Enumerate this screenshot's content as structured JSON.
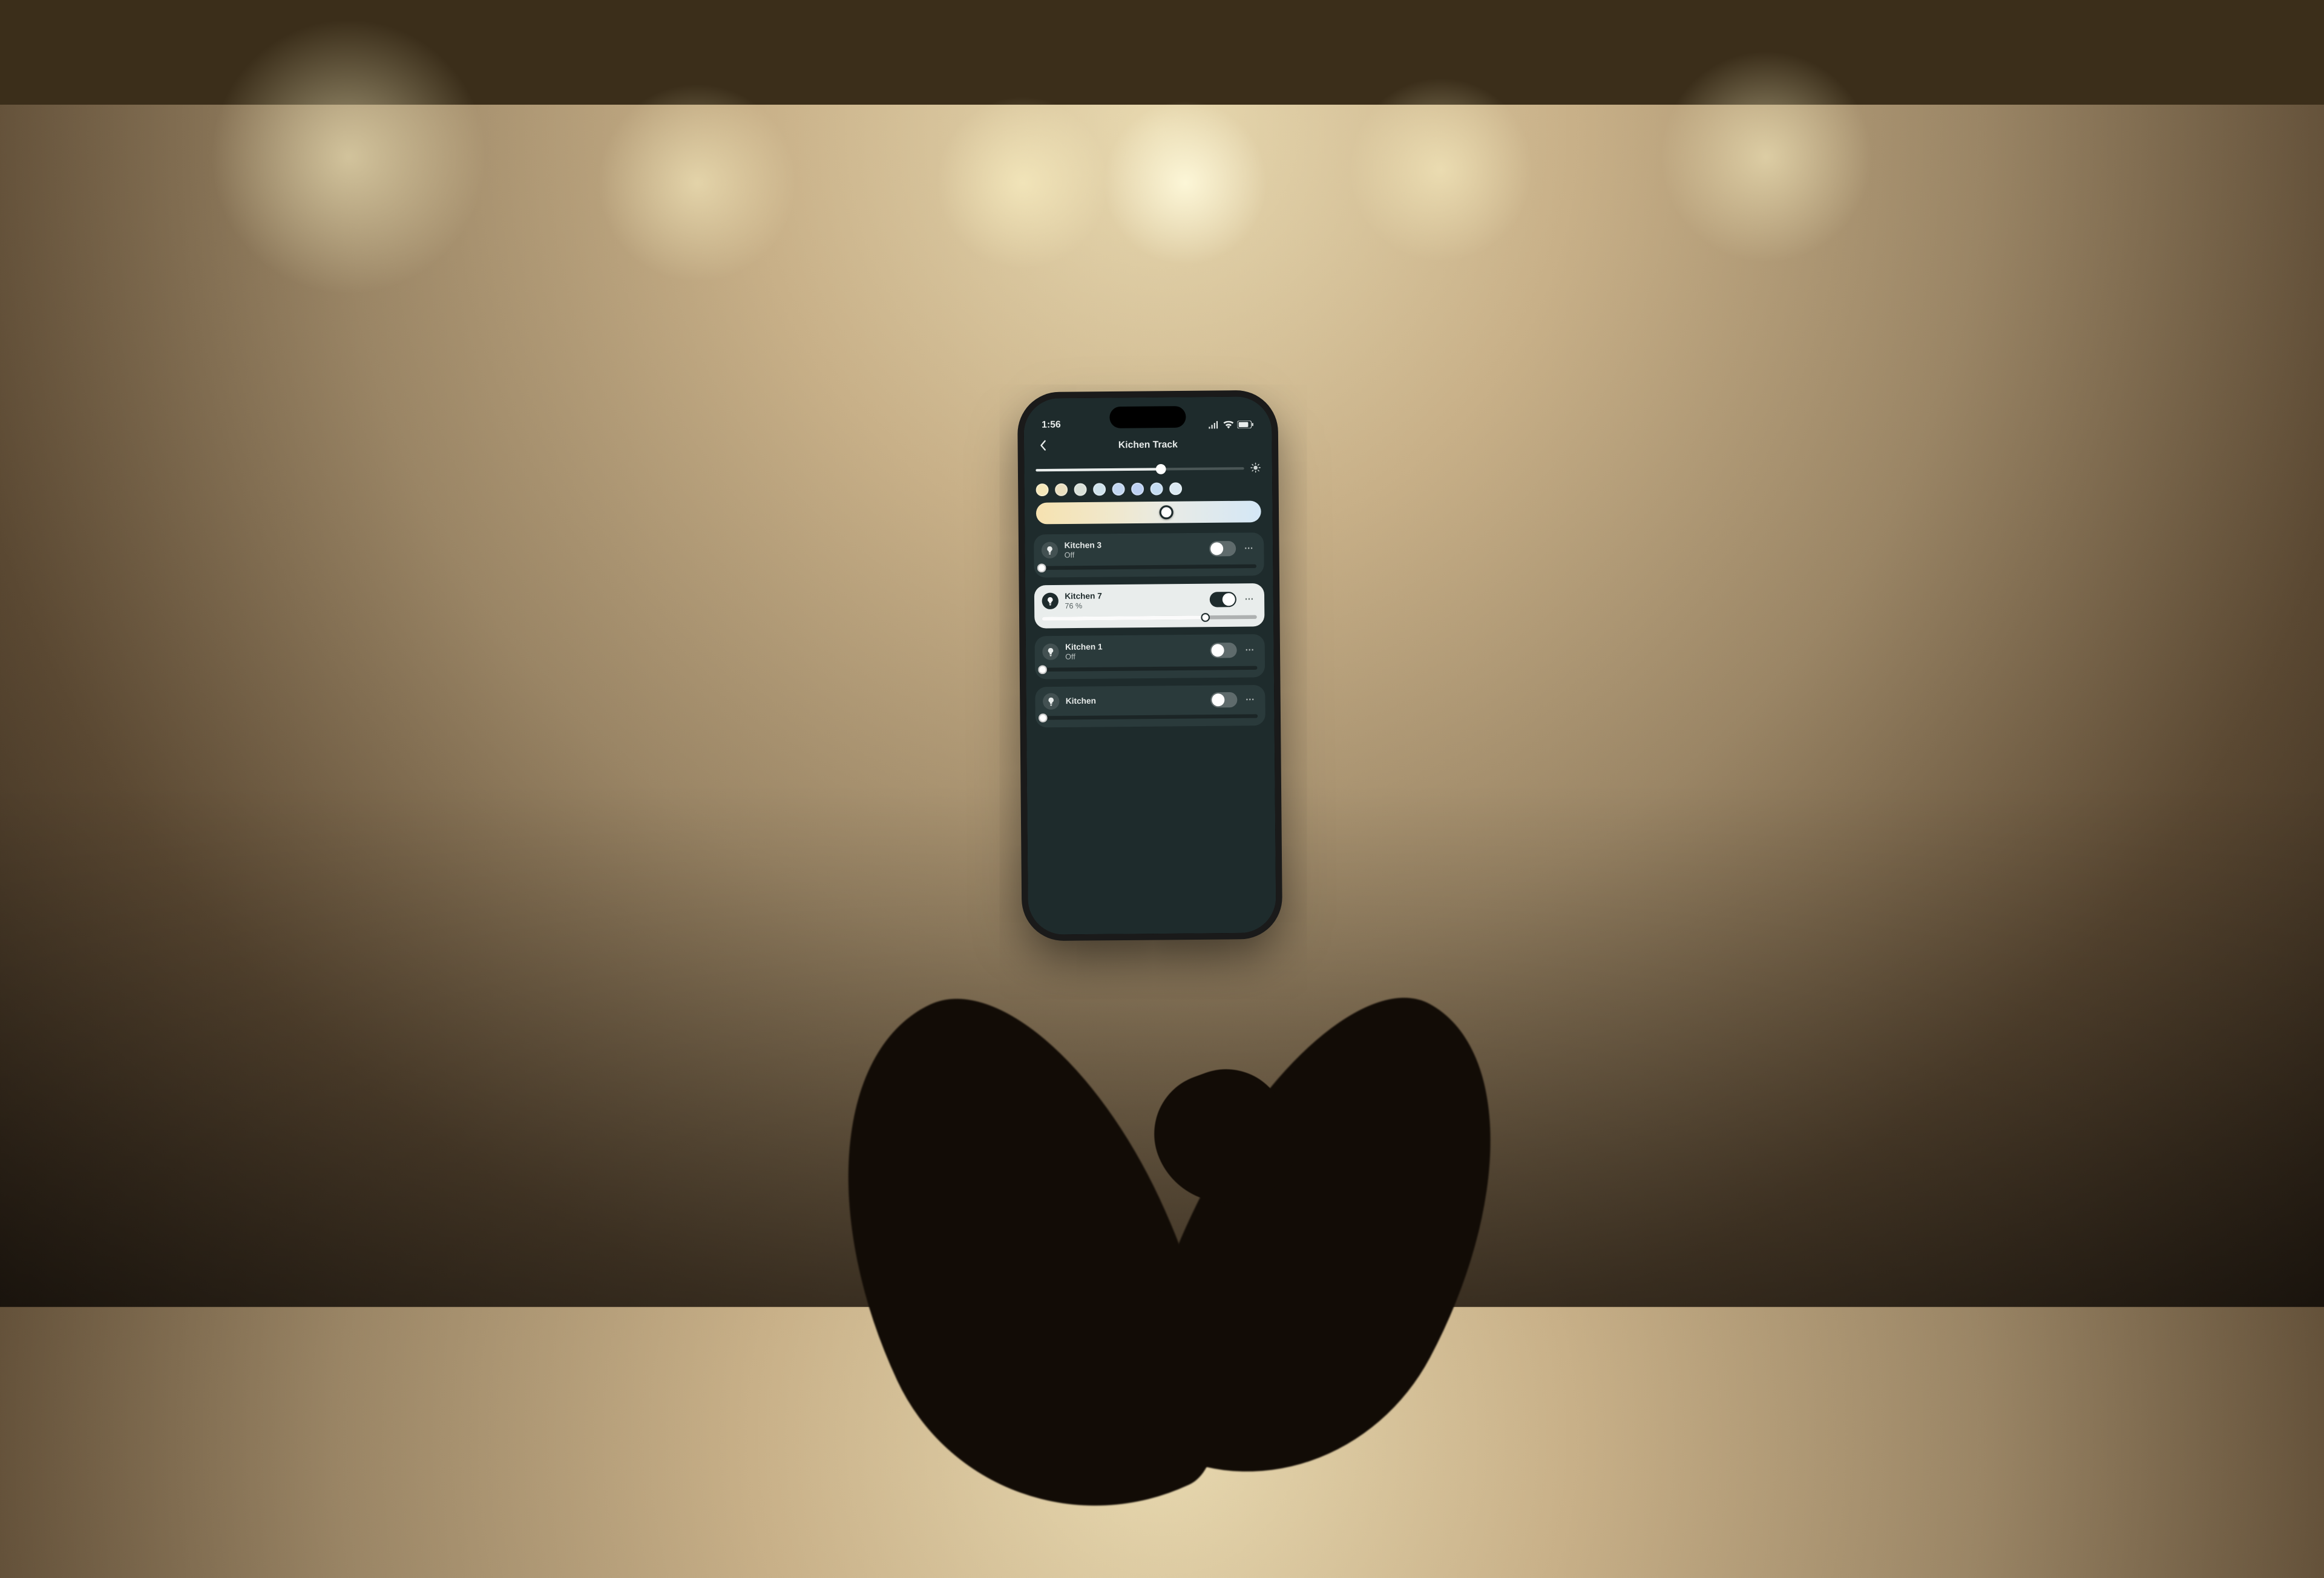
{
  "status": {
    "time": "1:56"
  },
  "header": {
    "title": "Kichen Track"
  },
  "group": {
    "brightness_percent": 60
  },
  "presets": [
    {
      "color": "#f5e7b9"
    },
    {
      "color": "#eadfbf"
    },
    {
      "color": "#d9e0d8"
    },
    {
      "color": "#cfe2ec"
    },
    {
      "color": "#c2d6f1"
    },
    {
      "color": "#bcd0f2"
    },
    {
      "color": "#c4dbf1"
    },
    {
      "color": "#dae8f1"
    }
  ],
  "ct_slider": {
    "percent": 58
  },
  "devices": [
    {
      "name": "Kitchen 3",
      "status_text": "Off",
      "on": false,
      "brightness_percent": 0
    },
    {
      "name": "Kitchen 7",
      "status_text": "76 %",
      "on": true,
      "brightness_percent": 76
    },
    {
      "name": "Kitchen 1",
      "status_text": "Off",
      "on": false,
      "brightness_percent": 0
    },
    {
      "name": "Kitchen",
      "status_text": "",
      "on": false,
      "brightness_percent": 0
    }
  ],
  "colors": {
    "screen_bg": "#1e2b2c",
    "card_dark": "#2a3a3b",
    "card_light": "#e9edec"
  }
}
